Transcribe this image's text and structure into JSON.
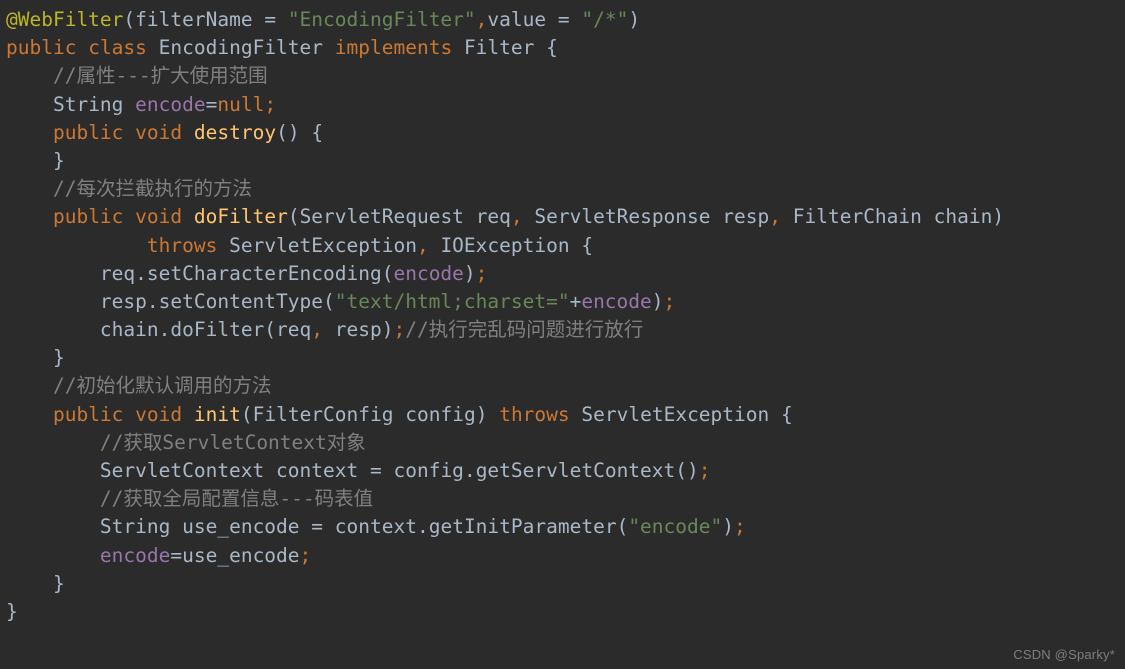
{
  "editor": {
    "theme": "darcula",
    "background_color": "#2b2b2b",
    "language": "java",
    "colors": {
      "default_text": "#a9b7c6",
      "keyword": "#cc7832",
      "annotation": "#bbb529",
      "string": "#6a8759",
      "comment": "#808080",
      "method_declaration": "#ffc66d",
      "instance_field": "#9876aa",
      "separator": "#cc7832"
    }
  },
  "code": {
    "lines": [
      "@WebFilter(filterName = \"EncodingFilter\",value = \"/*\")",
      "public class EncodingFilter implements Filter {",
      "    //属性---扩大使用范围",
      "    String encode=null;",
      "    public void destroy() {",
      "    }",
      "    //每次拦截执行的方法",
      "    public void doFilter(ServletRequest req, ServletResponse resp, FilterChain chain)",
      "            throws ServletException, IOException {",
      "        req.setCharacterEncoding(encode);",
      "        resp.setContentType(\"text/html;charset=\"+encode);",
      "        chain.doFilter(req, resp);//执行完乱码问题进行放行",
      "    }",
      "    //初始化默认调用的方法",
      "    public void init(FilterConfig config) throws ServletException {",
      "        //获取ServletContext对象",
      "        ServletContext context = config.getServletContext();",
      "        //获取全局配置信息---码表值",
      "        String use_encode = context.getInitParameter(\"encode\");",
      "        encode=use_encode;",
      "    }",
      "}"
    ],
    "line_count": 22,
    "class_name": "EncodingFilter",
    "annotation": {
      "name": "@WebFilter",
      "filterName": "EncodingFilter",
      "value": "/*"
    },
    "methods": [
      "destroy",
      "doFilter",
      "init"
    ],
    "fields": [
      "encode"
    ],
    "comments": [
      "//属性---扩大使用范围",
      "//每次拦截执行的方法",
      "//执行完乱码问题进行放行",
      "//初始化默认调用的方法",
      "//获取ServletContext对象",
      "//获取全局配置信息---码表值"
    ]
  },
  "watermark": {
    "text": "CSDN @Sparky*"
  }
}
